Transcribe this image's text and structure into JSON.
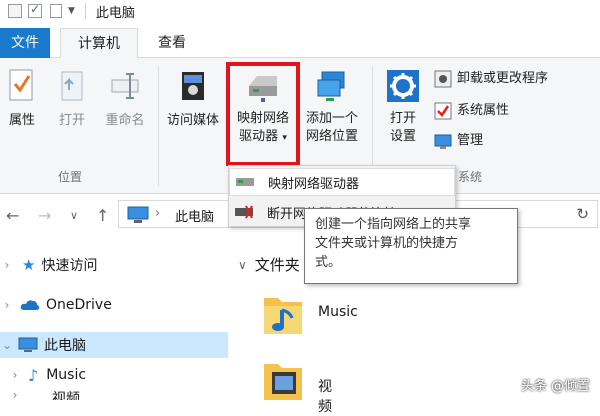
{
  "window": {
    "title": "此电脑"
  },
  "tabs": {
    "file": "文件",
    "computer": "计算机",
    "view": "查看"
  },
  "ribbon": {
    "properties": "属性",
    "open": "打开",
    "rename": "重命名",
    "access_media": "访问媒体",
    "map_drive_line1": "映射网络",
    "map_drive_line2": "驱动器",
    "add_location_line1": "添加一个",
    "add_location_line2": "网络位置",
    "open_settings_line1": "打开",
    "open_settings_line2": "设置",
    "uninstall": "卸载或更改程序",
    "system_props": "系统属性",
    "manage": "管理",
    "group_location": "位置",
    "group_system": "系统"
  },
  "menu": {
    "items": [
      {
        "label": "映射网络驱动器",
        "icon": "network-drive-icon"
      },
      {
        "label": "断开网络驱动器的连接",
        "icon": "disconnect-drive-icon"
      }
    ]
  },
  "tooltip": {
    "line1": "创建一个指向网络上的共享",
    "line2": "文件夹或计算机的快捷方",
    "line3": "式。"
  },
  "address": {
    "path": "此电脑"
  },
  "nav": {
    "quick_access": "快速访问",
    "onedrive": "OneDrive",
    "this_pc": "此电脑",
    "music": "Music",
    "video": "视频"
  },
  "content": {
    "section": "文件夹",
    "folders": [
      "Music",
      "视频"
    ]
  },
  "watermark": "头条 @倾置",
  "colors": {
    "accent": "#1979ca",
    "highlight": "#e0141e",
    "selected": "#cce8ff"
  }
}
